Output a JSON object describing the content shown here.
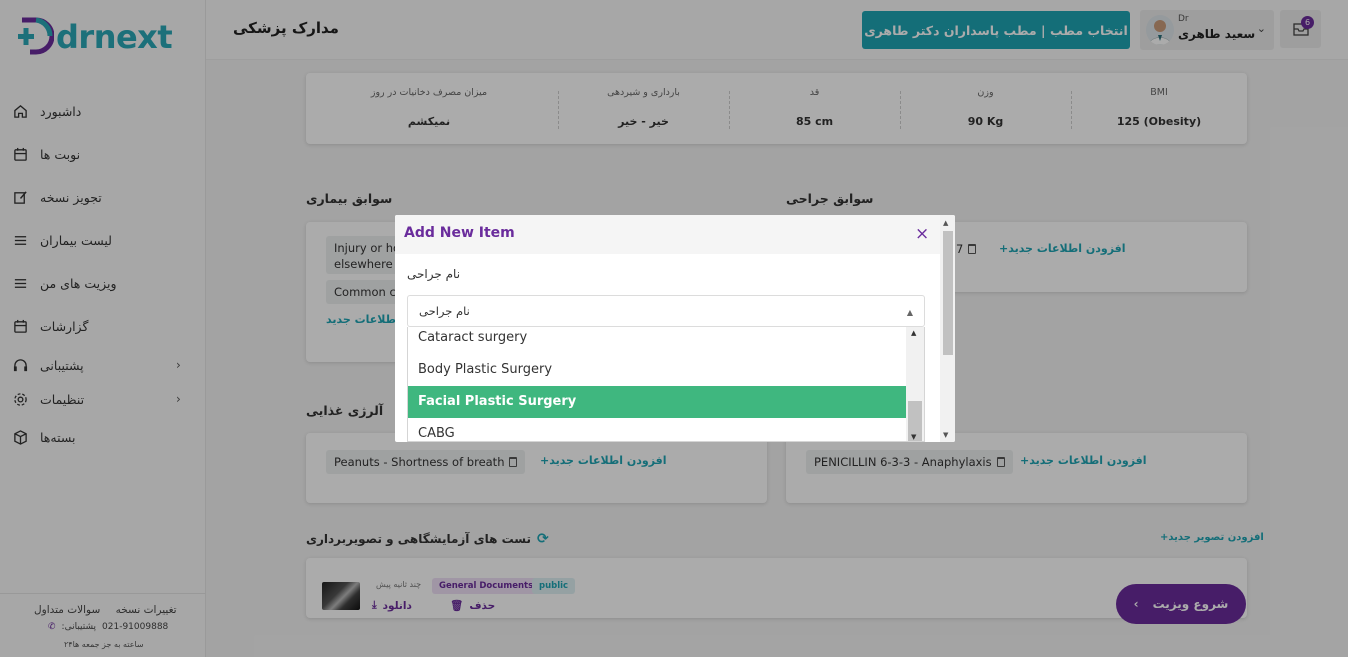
{
  "brand": {
    "logo_text": "drnext",
    "accent": "#1fa4b4",
    "purple": "#6a2c9c",
    "green": "#3fb77f"
  },
  "header": {
    "page_title": "مدارک پزشکی",
    "office_button": "انتخاب مطب | مطب پاسداران دکتر طاهری",
    "user_role": "Dr",
    "user_name": "سعید طاهری",
    "notifications": "6"
  },
  "sidebar": {
    "items": [
      {
        "label": "داشبورد",
        "icon": "home-icon"
      },
      {
        "label": "نوبت ها",
        "icon": "calendar-icon"
      },
      {
        "label": "تجویز نسخه",
        "icon": "edit-icon"
      },
      {
        "label": "لیست بیماران",
        "icon": "list-icon"
      },
      {
        "label": "ویزیت های من",
        "icon": "list-icon"
      },
      {
        "label": "گزارشات",
        "icon": "calendar-icon"
      },
      {
        "label": "پشتیبانی",
        "icon": "headset-icon"
      },
      {
        "label": "تنظیمات",
        "icon": "gear-icon"
      },
      {
        "label": "بسته‌ها",
        "icon": "package-icon"
      }
    ],
    "footer": {
      "faq": "سوالات متداول",
      "changes": "تغییرات نسخه",
      "phone": "021-91009888",
      "support_label": ":پشتیبانی",
      "hours": "۲۴ساعته به جز جمعه ها"
    }
  },
  "vitals": [
    {
      "label": "BMI",
      "value": "125 (Obesity)"
    },
    {
      "label": "وزن",
      "value": "90 Kg"
    },
    {
      "label": "قد",
      "value": "85 cm"
    },
    {
      "label": "بارداری و شیردهی",
      "value": "خیر - خیر"
    },
    {
      "label": "میزان مصرف دخانیات در روز",
      "value": "نمیکشم"
    }
  ],
  "sections": {
    "disease_history": "سوابق بیماری",
    "surgery_history": "سوابق جراحی",
    "food_allergy": "آلرژی غذایی",
    "lab_tests": "تست های آزمایشگاهی و تصویربرداری"
  },
  "disease_tags": [
    "Injury or ho",
    "elsewhere",
    "Common c"
  ],
  "surgery_tag_fragment": "7",
  "food_allergy_tag": "Peanuts - Shortness of breath",
  "drug_allergy_tag": "PENICILLIN 6-3-3 - Anaphylaxis",
  "add_new": "+افزودن اطلاعات جدید",
  "add_new_partial": "اطلاعات جدید",
  "add_image": "+افزودن تصویر جدید",
  "document": {
    "public_badge": "public",
    "category_badge": "General Documents",
    "time": "چند ثانیه پیش",
    "delete": "حذف",
    "download": "دانلود"
  },
  "start_visit": "شروع ویزیت",
  "modal": {
    "title": "Add New Item",
    "field_label": "نام جراحی",
    "select_placeholder": "نام جراحی",
    "options": [
      "Cataract surgery",
      "Body Plastic Surgery",
      "Facial Plastic Surgery",
      "CABG"
    ],
    "selected": "Facial Plastic Surgery"
  }
}
